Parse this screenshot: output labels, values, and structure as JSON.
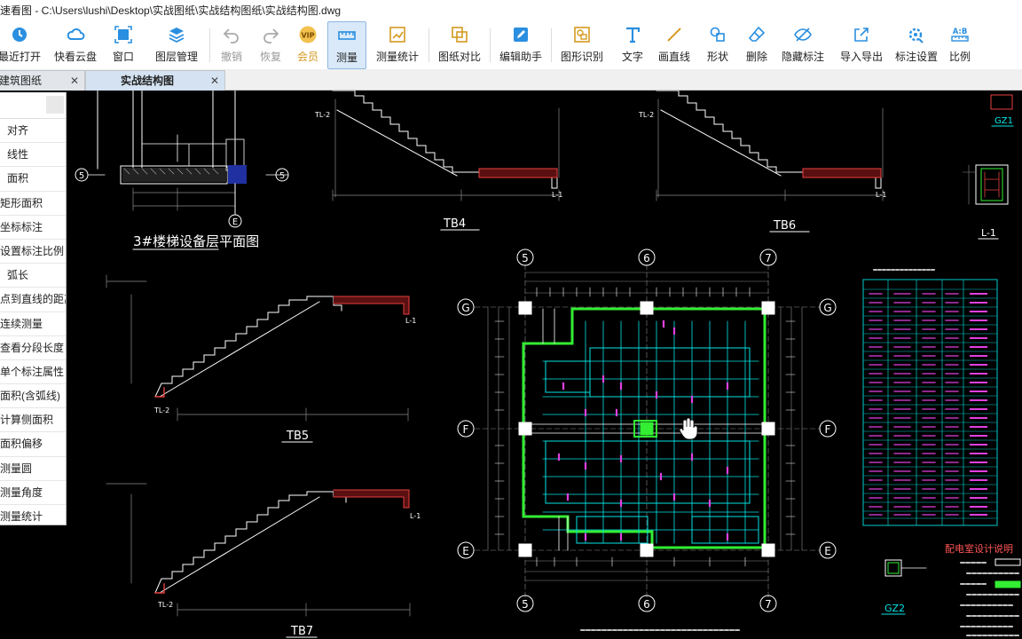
{
  "window": {
    "title": "速看图 - C:\\Users\\lushi\\Desktop\\实战图纸\\实战结构图纸\\实战结构图.dwg"
  },
  "toolbar": {
    "items": [
      {
        "label": "最近打开",
        "icon": "clock-icon"
      },
      {
        "label": "快看云盘",
        "icon": "cloud-icon"
      },
      {
        "label": "窗口",
        "icon": "window-icon"
      },
      {
        "label": "图层管理",
        "icon": "layers-icon"
      },
      {
        "label": "撤销",
        "icon": "undo-icon"
      },
      {
        "label": "恢复",
        "icon": "redo-icon"
      },
      {
        "label": "会员",
        "icon": "vip-icon",
        "badge": "VIP"
      },
      {
        "label": "测量",
        "icon": "ruler-icon"
      },
      {
        "label": "测量统计",
        "icon": "measure-stats-icon"
      },
      {
        "label": "图纸对比",
        "icon": "compare-icon"
      },
      {
        "label": "编辑助手",
        "icon": "edit-assistant-icon"
      },
      {
        "label": "图形识别",
        "icon": "shape-recognize-icon"
      },
      {
        "label": "文字",
        "icon": "text-icon"
      },
      {
        "label": "画直线",
        "icon": "line-icon"
      },
      {
        "label": "形状",
        "icon": "shape-icon"
      },
      {
        "label": "删除",
        "icon": "eraser-icon"
      },
      {
        "label": "隐藏标注",
        "icon": "eye-hide-icon"
      },
      {
        "label": "导入导出",
        "icon": "import-export-icon"
      },
      {
        "label": "标注设置",
        "icon": "annotation-settings-icon"
      },
      {
        "label": "比例",
        "icon": "scale-icon",
        "badge": "A:B"
      }
    ]
  },
  "tabs": [
    {
      "label": "建筑图纸",
      "close": "✕"
    },
    {
      "label": "实战结构图",
      "close": "✕"
    }
  ],
  "measure_menu": {
    "items": [
      "对齐",
      "线性",
      "面积",
      "矩形面积",
      "坐标标注",
      "设置标注比例",
      "弧长",
      "点到直线的距离",
      "连续测量",
      "查看分段长度",
      "单个标注属性",
      "面积(含弧线)",
      "计算侧面积",
      "面积偏移",
      "测量圆",
      "测量角度",
      "测量统计"
    ]
  },
  "drawing": {
    "colors": {
      "background": "#000000",
      "line_white": "#ffffff",
      "stair": "#ffffff",
      "dim": "#8a8a8a",
      "red_slab": "#e84040",
      "green_wall": "#33ee33",
      "cyan_grid": "#00e5e5",
      "magenta": "#e040e0",
      "table_cyan": "#00cccc",
      "title_red": "#ff5555"
    },
    "titles": {
      "tb4": "TB4",
      "tb5": "TB5",
      "tb6": "TB6",
      "tb7": "TB7",
      "plan_caption": "3#楼梯设备层平面图",
      "gz1": "GZ1",
      "gz2": "GZ2",
      "l1": "L-1",
      "notes_title": "配电室设计说明"
    },
    "axes": {
      "5": "5",
      "6": "6",
      "7": "7",
      "G": "G",
      "F": "F",
      "E": "E"
    },
    "labels": {
      "tl2": "TL-2",
      "l1": "L-1"
    }
  }
}
